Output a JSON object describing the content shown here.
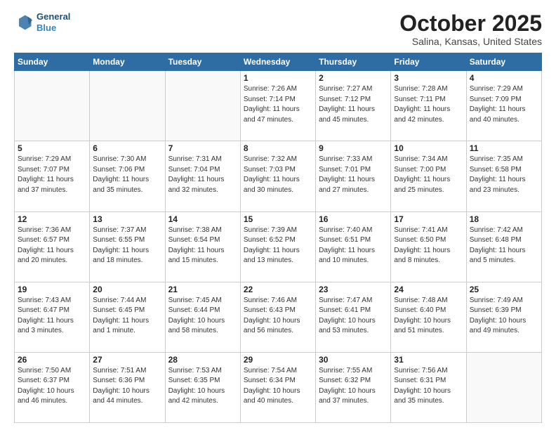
{
  "header": {
    "logo_line1": "General",
    "logo_line2": "Blue",
    "month": "October 2025",
    "location": "Salina, Kansas, United States"
  },
  "weekdays": [
    "Sunday",
    "Monday",
    "Tuesday",
    "Wednesday",
    "Thursday",
    "Friday",
    "Saturday"
  ],
  "rows": [
    [
      {
        "day": "",
        "detail": ""
      },
      {
        "day": "",
        "detail": ""
      },
      {
        "day": "",
        "detail": ""
      },
      {
        "day": "1",
        "detail": "Sunrise: 7:26 AM\nSunset: 7:14 PM\nDaylight: 11 hours\nand 47 minutes."
      },
      {
        "day": "2",
        "detail": "Sunrise: 7:27 AM\nSunset: 7:12 PM\nDaylight: 11 hours\nand 45 minutes."
      },
      {
        "day": "3",
        "detail": "Sunrise: 7:28 AM\nSunset: 7:11 PM\nDaylight: 11 hours\nand 42 minutes."
      },
      {
        "day": "4",
        "detail": "Sunrise: 7:29 AM\nSunset: 7:09 PM\nDaylight: 11 hours\nand 40 minutes."
      }
    ],
    [
      {
        "day": "5",
        "detail": "Sunrise: 7:29 AM\nSunset: 7:07 PM\nDaylight: 11 hours\nand 37 minutes."
      },
      {
        "day": "6",
        "detail": "Sunrise: 7:30 AM\nSunset: 7:06 PM\nDaylight: 11 hours\nand 35 minutes."
      },
      {
        "day": "7",
        "detail": "Sunrise: 7:31 AM\nSunset: 7:04 PM\nDaylight: 11 hours\nand 32 minutes."
      },
      {
        "day": "8",
        "detail": "Sunrise: 7:32 AM\nSunset: 7:03 PM\nDaylight: 11 hours\nand 30 minutes."
      },
      {
        "day": "9",
        "detail": "Sunrise: 7:33 AM\nSunset: 7:01 PM\nDaylight: 11 hours\nand 27 minutes."
      },
      {
        "day": "10",
        "detail": "Sunrise: 7:34 AM\nSunset: 7:00 PM\nDaylight: 11 hours\nand 25 minutes."
      },
      {
        "day": "11",
        "detail": "Sunrise: 7:35 AM\nSunset: 6:58 PM\nDaylight: 11 hours\nand 23 minutes."
      }
    ],
    [
      {
        "day": "12",
        "detail": "Sunrise: 7:36 AM\nSunset: 6:57 PM\nDaylight: 11 hours\nand 20 minutes."
      },
      {
        "day": "13",
        "detail": "Sunrise: 7:37 AM\nSunset: 6:55 PM\nDaylight: 11 hours\nand 18 minutes."
      },
      {
        "day": "14",
        "detail": "Sunrise: 7:38 AM\nSunset: 6:54 PM\nDaylight: 11 hours\nand 15 minutes."
      },
      {
        "day": "15",
        "detail": "Sunrise: 7:39 AM\nSunset: 6:52 PM\nDaylight: 11 hours\nand 13 minutes."
      },
      {
        "day": "16",
        "detail": "Sunrise: 7:40 AM\nSunset: 6:51 PM\nDaylight: 11 hours\nand 10 minutes."
      },
      {
        "day": "17",
        "detail": "Sunrise: 7:41 AM\nSunset: 6:50 PM\nDaylight: 11 hours\nand 8 minutes."
      },
      {
        "day": "18",
        "detail": "Sunrise: 7:42 AM\nSunset: 6:48 PM\nDaylight: 11 hours\nand 5 minutes."
      }
    ],
    [
      {
        "day": "19",
        "detail": "Sunrise: 7:43 AM\nSunset: 6:47 PM\nDaylight: 11 hours\nand 3 minutes."
      },
      {
        "day": "20",
        "detail": "Sunrise: 7:44 AM\nSunset: 6:45 PM\nDaylight: 11 hours\nand 1 minute."
      },
      {
        "day": "21",
        "detail": "Sunrise: 7:45 AM\nSunset: 6:44 PM\nDaylight: 10 hours\nand 58 minutes."
      },
      {
        "day": "22",
        "detail": "Sunrise: 7:46 AM\nSunset: 6:43 PM\nDaylight: 10 hours\nand 56 minutes."
      },
      {
        "day": "23",
        "detail": "Sunrise: 7:47 AM\nSunset: 6:41 PM\nDaylight: 10 hours\nand 53 minutes."
      },
      {
        "day": "24",
        "detail": "Sunrise: 7:48 AM\nSunset: 6:40 PM\nDaylight: 10 hours\nand 51 minutes."
      },
      {
        "day": "25",
        "detail": "Sunrise: 7:49 AM\nSunset: 6:39 PM\nDaylight: 10 hours\nand 49 minutes."
      }
    ],
    [
      {
        "day": "26",
        "detail": "Sunrise: 7:50 AM\nSunset: 6:37 PM\nDaylight: 10 hours\nand 46 minutes."
      },
      {
        "day": "27",
        "detail": "Sunrise: 7:51 AM\nSunset: 6:36 PM\nDaylight: 10 hours\nand 44 minutes."
      },
      {
        "day": "28",
        "detail": "Sunrise: 7:53 AM\nSunset: 6:35 PM\nDaylight: 10 hours\nand 42 minutes."
      },
      {
        "day": "29",
        "detail": "Sunrise: 7:54 AM\nSunset: 6:34 PM\nDaylight: 10 hours\nand 40 minutes."
      },
      {
        "day": "30",
        "detail": "Sunrise: 7:55 AM\nSunset: 6:32 PM\nDaylight: 10 hours\nand 37 minutes."
      },
      {
        "day": "31",
        "detail": "Sunrise: 7:56 AM\nSunset: 6:31 PM\nDaylight: 10 hours\nand 35 minutes."
      },
      {
        "day": "",
        "detail": ""
      }
    ]
  ]
}
